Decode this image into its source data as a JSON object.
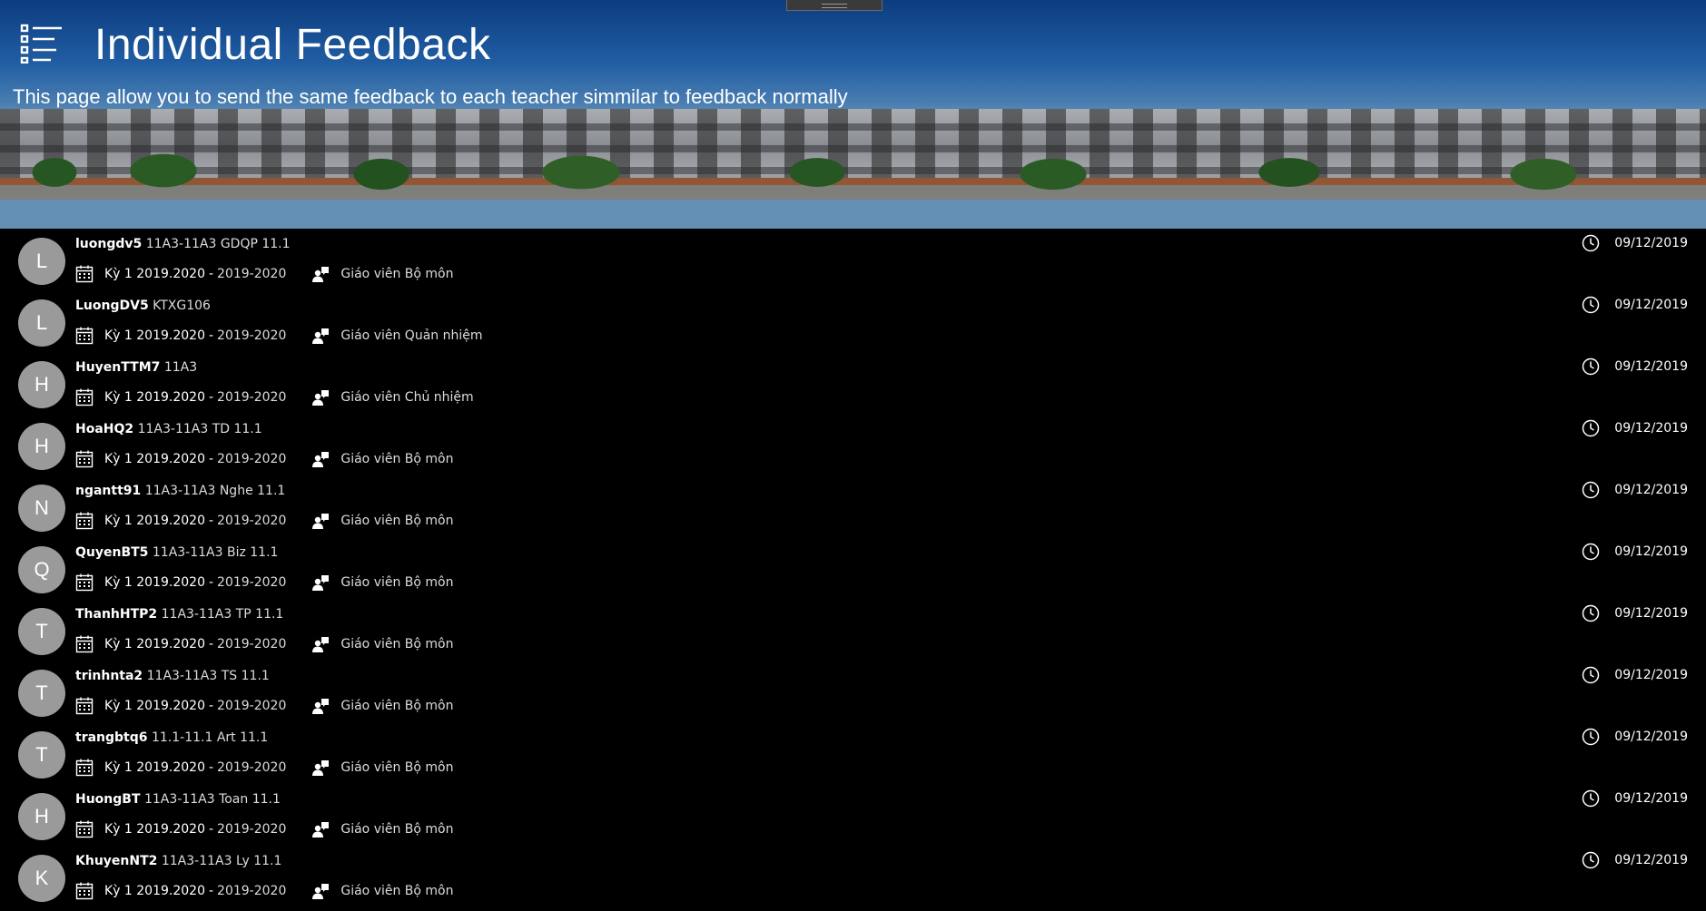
{
  "header": {
    "title": "Individual Feedback",
    "subtitle": "This page allow you to send the same feedback to each teacher simmilar to feedback normally",
    "menu_icon": "list-menu-icon"
  },
  "icons": {
    "term": "calendar-icon",
    "role": "teacher-icon",
    "date": "clock-icon"
  },
  "feedbacks": [
    {
      "initial": "L",
      "username": "luongdv5",
      "class_info": "11A3-11A3 GDQP 11.1",
      "term": "Kỳ 1 2019.2020",
      "year": "2019-2020",
      "role": "Giáo viên Bộ môn",
      "date": "09/12/2019"
    },
    {
      "initial": "L",
      "username": "LuongDV5",
      "class_info": "KTXG106",
      "term": "Kỳ 1 2019.2020",
      "year": "2019-2020",
      "role": "Giáo viên Quản nhiệm",
      "date": "09/12/2019"
    },
    {
      "initial": "H",
      "username": "HuyenTTM7",
      "class_info": "11A3",
      "term": "Kỳ 1 2019.2020",
      "year": "2019-2020",
      "role": "Giáo viên Chủ nhiệm",
      "date": "09/12/2019"
    },
    {
      "initial": "H",
      "username": "HoaHQ2",
      "class_info": "11A3-11A3 TD 11.1",
      "term": "Kỳ 1 2019.2020",
      "year": "2019-2020",
      "role": "Giáo viên Bộ môn",
      "date": "09/12/2019"
    },
    {
      "initial": "N",
      "username": "ngantt91",
      "class_info": "11A3-11A3 Nghe 11.1",
      "term": "Kỳ 1 2019.2020",
      "year": "2019-2020",
      "role": "Giáo viên Bộ môn",
      "date": "09/12/2019"
    },
    {
      "initial": "Q",
      "username": "QuyenBT5",
      "class_info": "11A3-11A3 Biz 11.1",
      "term": "Kỳ 1 2019.2020",
      "year": "2019-2020",
      "role": "Giáo viên Bộ môn",
      "date": "09/12/2019"
    },
    {
      "initial": "T",
      "username": "ThanhHTP2",
      "class_info": "11A3-11A3 TP 11.1",
      "term": "Kỳ 1 2019.2020",
      "year": "2019-2020",
      "role": "Giáo viên Bộ môn",
      "date": "09/12/2019"
    },
    {
      "initial": "T",
      "username": "trinhnta2",
      "class_info": "11A3-11A3 TS 11.1",
      "term": "Kỳ 1 2019.2020",
      "year": "2019-2020",
      "role": "Giáo viên Bộ môn",
      "date": "09/12/2019"
    },
    {
      "initial": "T",
      "username": "trangbtq6",
      "class_info": "11.1-11.1 Art 11.1",
      "term": "Kỳ 1 2019.2020",
      "year": "2019-2020",
      "role": "Giáo viên Bộ môn",
      "date": "09/12/2019"
    },
    {
      "initial": "H",
      "username": "HuongBT",
      "class_info": "11A3-11A3 Toan 11.1",
      "term": "Kỳ 1 2019.2020",
      "year": "2019-2020",
      "role": "Giáo viên Bộ môn",
      "date": "09/12/2019"
    },
    {
      "initial": "K",
      "username": "KhuyenNT2",
      "class_info": "11A3-11A3 Ly 11.1",
      "term": "Kỳ 1 2019.2020",
      "year": "2019-2020",
      "role": "Giáo viên Bộ môn",
      "date": "09/12/2019"
    }
  ]
}
